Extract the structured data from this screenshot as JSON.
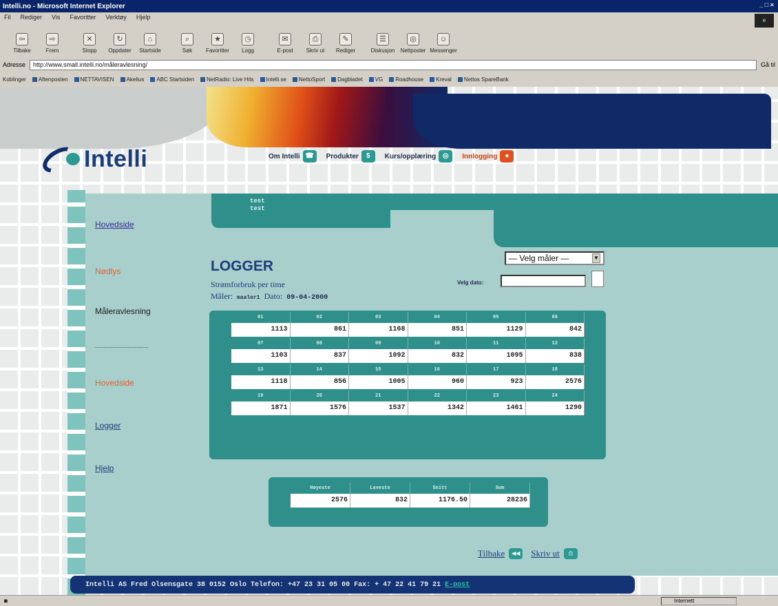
{
  "window": {
    "title": "Intelli.no - Microsoft Internet Explorer",
    "controls": "_ □ ×"
  },
  "menubar": [
    "Fil",
    "Rediger",
    "Vis",
    "Favoritter",
    "Verktøy",
    "Hjelp"
  ],
  "toolbar": [
    {
      "label": "Tilbake",
      "icon": "back-arrow-icon",
      "glyph": "⇦"
    },
    {
      "label": "Frem",
      "icon": "forward-arrow-icon",
      "glyph": "⇨"
    },
    {
      "label": "Stopp",
      "icon": "stop-icon",
      "glyph": "✕"
    },
    {
      "label": "Oppdater",
      "icon": "refresh-icon",
      "glyph": "↻"
    },
    {
      "label": "Startside",
      "icon": "home-icon",
      "glyph": "⌂"
    },
    {
      "label": "Søk",
      "icon": "search-icon",
      "glyph": "⌕"
    },
    {
      "label": "Favoritter",
      "icon": "favorites-icon",
      "glyph": "★"
    },
    {
      "label": "Logg",
      "icon": "history-icon",
      "glyph": "◷"
    },
    {
      "label": "E-post",
      "icon": "mail-icon",
      "glyph": "✉"
    },
    {
      "label": "Skriv ut",
      "icon": "print-icon",
      "glyph": "⎙"
    },
    {
      "label": "Rediger",
      "icon": "edit-icon",
      "glyph": "✎"
    },
    {
      "label": "Diskusjon",
      "icon": "discuss-icon",
      "glyph": "☰"
    },
    {
      "label": "Nettposter",
      "icon": "web-icon",
      "glyph": "◎"
    },
    {
      "label": "Messenger",
      "icon": "messenger-icon",
      "glyph": "☺"
    }
  ],
  "address": {
    "label": "Adresse",
    "url": "http://www.small.intelli.no/måleravlesning/",
    "go": "Gå til"
  },
  "links": {
    "label": "Koblinger",
    "items": [
      "Aftenposten",
      "NETTAVISEN",
      "Akelius",
      "ABC Startsiden",
      "NetRadio: Live Hits",
      "Intelli.se",
      "NettoSport",
      "Dagbladet",
      "VG",
      "Roadhouse",
      "Kreval",
      "Nettos SpareBank"
    ]
  },
  "site": {
    "logo": "Intelli",
    "nav": [
      {
        "label": "Om Intelli",
        "glyph": "☎",
        "accent": false
      },
      {
        "label": "Produkter",
        "glyph": "$",
        "accent": false
      },
      {
        "label": "Kurs/opplæring",
        "glyph": "◎",
        "accent": false
      },
      {
        "label": "Innlogging",
        "glyph": "●",
        "accent": true
      }
    ],
    "menu": {
      "hovedside1": "Hovedside",
      "nodlys": "Nødlys",
      "maleravlesning": "Måleravlesning",
      "divider": "...............................",
      "hovedside2": "Hovedside",
      "logger": "Logger",
      "hjelp": "Hjelp"
    },
    "userbox": {
      "line1": "test",
      "line2": "test"
    },
    "title": "LOGGER",
    "subtitle": "Strømforbruk per time",
    "meter_label": "Måler:",
    "meter_value": "maaler1",
    "date_label": "Dato:",
    "date_value": "09-04-2000",
    "select_meter": "— Velg måler —",
    "date_field_label": "Velg dato:",
    "hourly": {
      "groups": [
        {
          "headers": [
            "01",
            "02",
            "03",
            "04",
            "05",
            "06"
          ],
          "values": [
            "1113",
            "861",
            "1168",
            "851",
            "1129",
            "842"
          ]
        },
        {
          "headers": [
            "07",
            "08",
            "09",
            "10",
            "11",
            "12"
          ],
          "values": [
            "1103",
            "837",
            "1092",
            "832",
            "1095",
            "838"
          ]
        },
        {
          "headers": [
            "13",
            "14",
            "15",
            "16",
            "17",
            "18"
          ],
          "values": [
            "1118",
            "856",
            "1005",
            "960",
            "923",
            "2576"
          ]
        },
        {
          "headers": [
            "19",
            "20",
            "21",
            "22",
            "23",
            "24"
          ],
          "values": [
            "1871",
            "1576",
            "1537",
            "1342",
            "1461",
            "1290"
          ]
        }
      ]
    },
    "summary": {
      "headers": [
        "Høyeste",
        "Laveste",
        "Snitt",
        "Sum"
      ],
      "values": [
        "2576",
        "832",
        "1176.50",
        "28236"
      ]
    },
    "actions": {
      "back": "Tilbake",
      "print": "Skriv ut"
    },
    "footer": {
      "company": "Intelli AS",
      "address": "Fred Olsensgate 38  0152 Oslo",
      "phone": "Telefon: +47 23 31 05 00",
      "fax": "Fax: + 47 22 41 79 21",
      "email": "E-post"
    }
  },
  "status": {
    "zone": "Internett"
  }
}
